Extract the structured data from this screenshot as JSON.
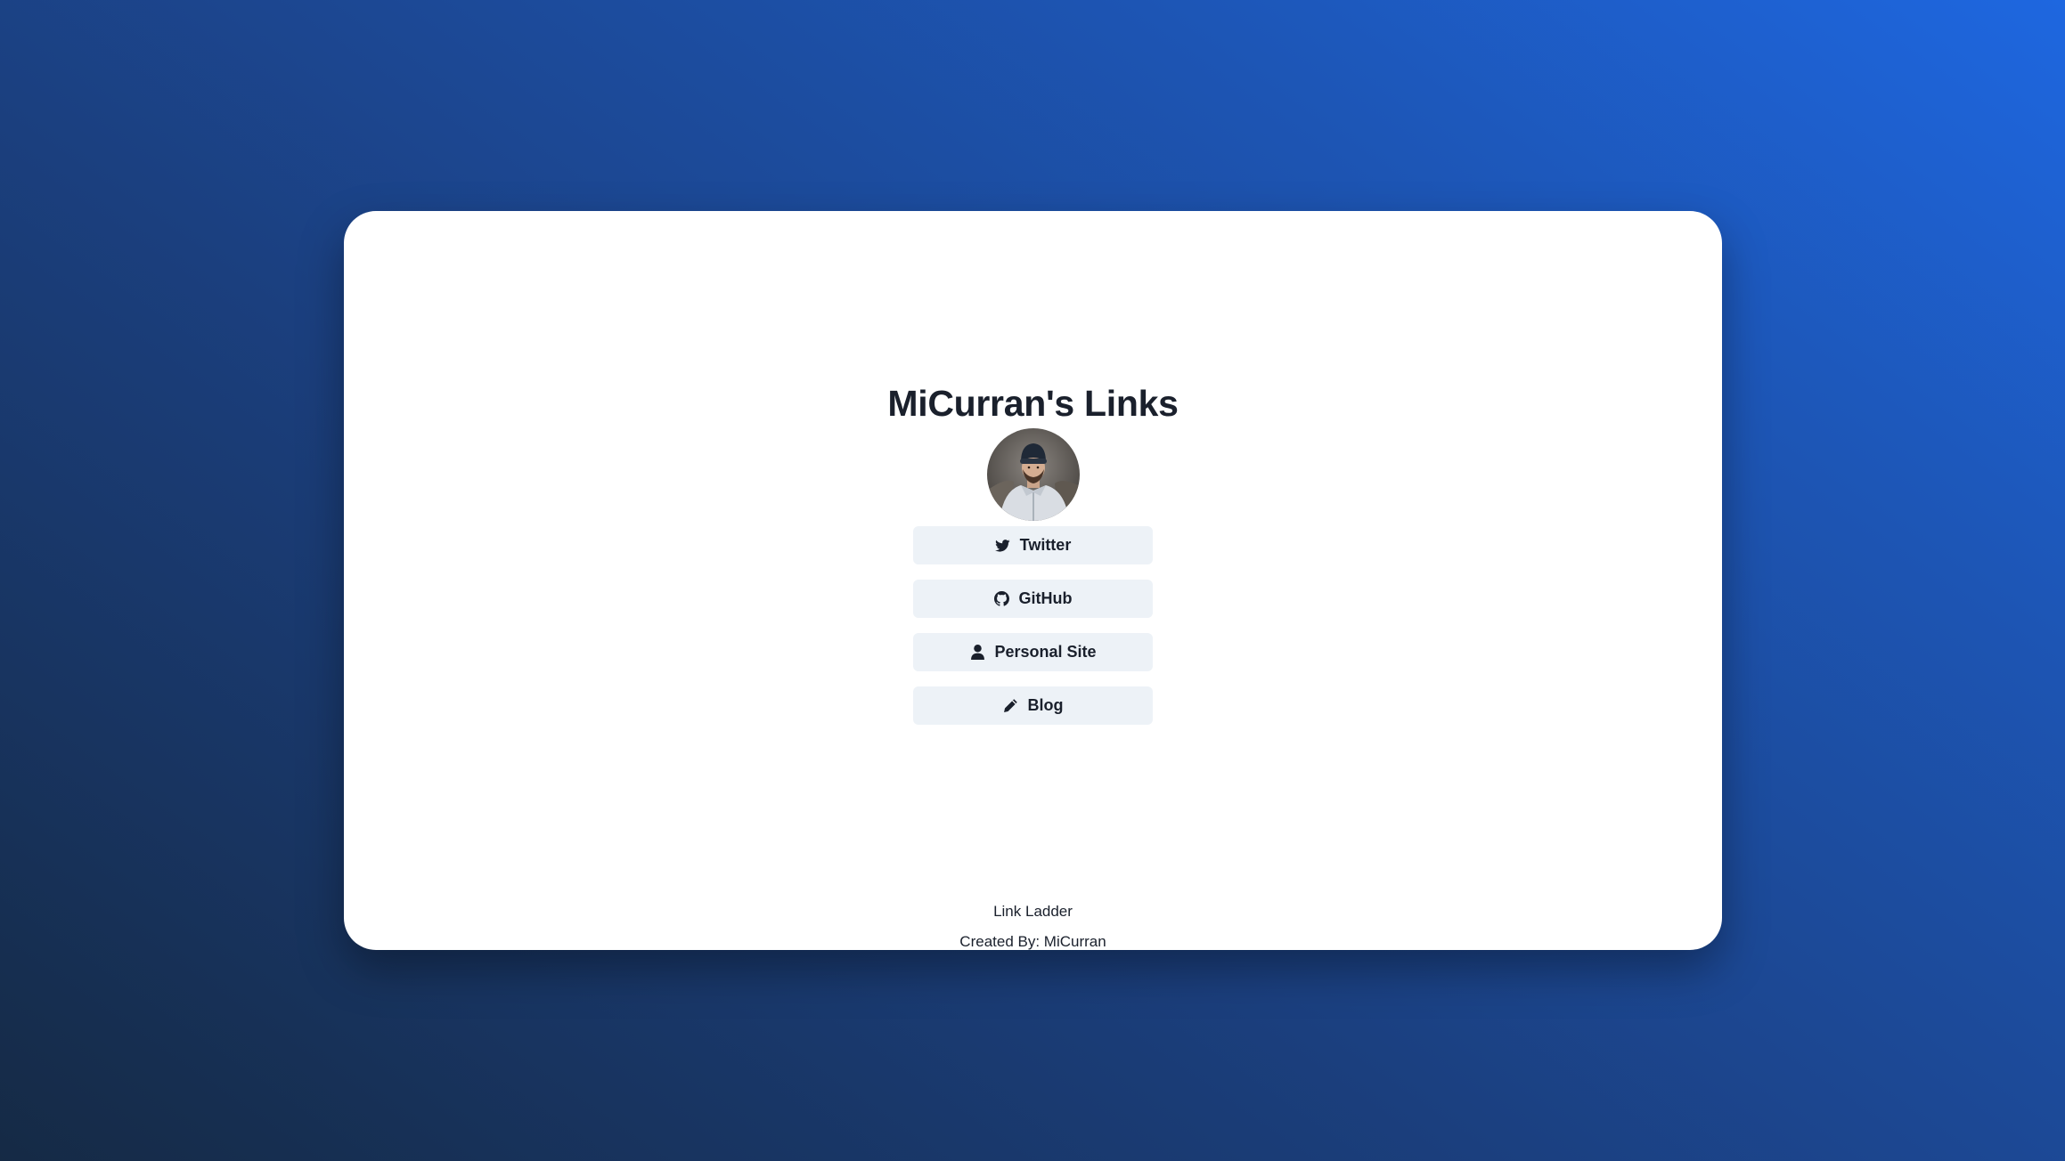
{
  "page": {
    "title": "MiCurran's Links"
  },
  "avatar": {
    "icon": "profile-photo"
  },
  "links": [
    {
      "label": "Twitter",
      "icon": "twitter-icon"
    },
    {
      "label": "GitHub",
      "icon": "github-icon"
    },
    {
      "label": "Personal Site",
      "icon": "user-icon"
    },
    {
      "label": "Blog",
      "icon": "pencil-icon"
    }
  ],
  "footer": {
    "app_name": "Link Ladder",
    "credit": "Created By: MiCurran"
  },
  "colors": {
    "button_bg": "#edf2f7",
    "text": "#1a202c",
    "card_bg": "#ffffff",
    "background_start": "#152a45",
    "background_end": "#1e67e0"
  }
}
